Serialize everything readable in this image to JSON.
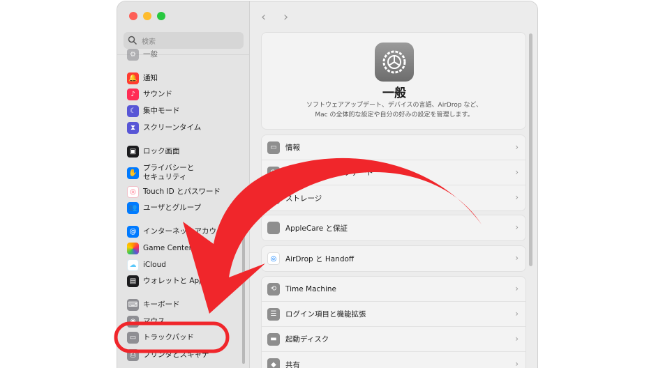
{
  "sidebar": {
    "search_placeholder": "検索",
    "items": [
      {
        "label": "一般",
        "icon": "gear-icon",
        "color": "#8e8e93"
      },
      {
        "label": "通知",
        "icon": "bell-icon",
        "color": "#ff3b30"
      },
      {
        "label": "サウンド",
        "icon": "speaker-icon",
        "color": "#ff2d55"
      },
      {
        "label": "集中モード",
        "icon": "moon-icon",
        "color": "#5856d6"
      },
      {
        "label": "スクリーンタイム",
        "icon": "hourglass-icon",
        "color": "#5856d6"
      },
      {
        "label": "ロック画面",
        "icon": "lock-icon",
        "color": "#1c1c1e"
      },
      {
        "label": "プライバシーと\nセキュリティ",
        "icon": "hand-icon",
        "color": "#007aff"
      },
      {
        "label": "Touch ID とパスワード",
        "icon": "fingerprint-icon",
        "color": "#ff6b81"
      },
      {
        "label": "ユーザとグループ",
        "icon": "users-icon",
        "color": "#007aff"
      },
      {
        "label": "インターネットアカウ",
        "icon": "at-icon",
        "color": "#007aff"
      },
      {
        "label": "Game Center",
        "icon": "gamecenter-icon",
        "color": "#ffcc00"
      },
      {
        "label": "iCloud",
        "icon": "cloud-icon",
        "color": "#5ac8fa"
      },
      {
        "label": "ウォレットと Apple P",
        "icon": "wallet-icon",
        "color": "#1c1c1e"
      },
      {
        "label": "キーボード",
        "icon": "keyboard-icon",
        "color": "#8e8e93"
      },
      {
        "label": "マウス",
        "icon": "mouse-icon",
        "color": "#8e8e93"
      },
      {
        "label": "トラックパッド",
        "icon": "trackpad-icon",
        "color": "#8e8e93"
      },
      {
        "label": "プリンタとスキャナ",
        "icon": "printer-icon",
        "color": "#8e8e93"
      }
    ]
  },
  "main": {
    "title": "一般",
    "description_line1": "ソフトウェアアップデート、デバイスの言語、AirDrop など、",
    "description_line2": "Mac の全体的な設定や自分の好みの設定を管理します。",
    "group1": [
      {
        "label": "情報",
        "icon": "laptop-icon"
      },
      {
        "label": "ソフトウェアアップデート",
        "icon": "update-icon"
      },
      {
        "label": "ストレージ",
        "icon": "storage-icon"
      }
    ],
    "group2": [
      {
        "label": "AppleCare と保証",
        "icon": "apple-icon"
      }
    ],
    "group3": [
      {
        "label": "AirDrop と Handoff",
        "icon": "airdrop-icon"
      }
    ],
    "group4": [
      {
        "label": "Time Machine",
        "icon": "timemachine-icon"
      },
      {
        "label": "ログイン項目と機能拡張",
        "icon": "list-icon"
      },
      {
        "label": "起動ディスク",
        "icon": "disk-icon"
      },
      {
        "label": "共有",
        "icon": "share-icon"
      }
    ]
  },
  "colors": {
    "arrow": "#f0262b",
    "highlight": "#f0262b"
  }
}
